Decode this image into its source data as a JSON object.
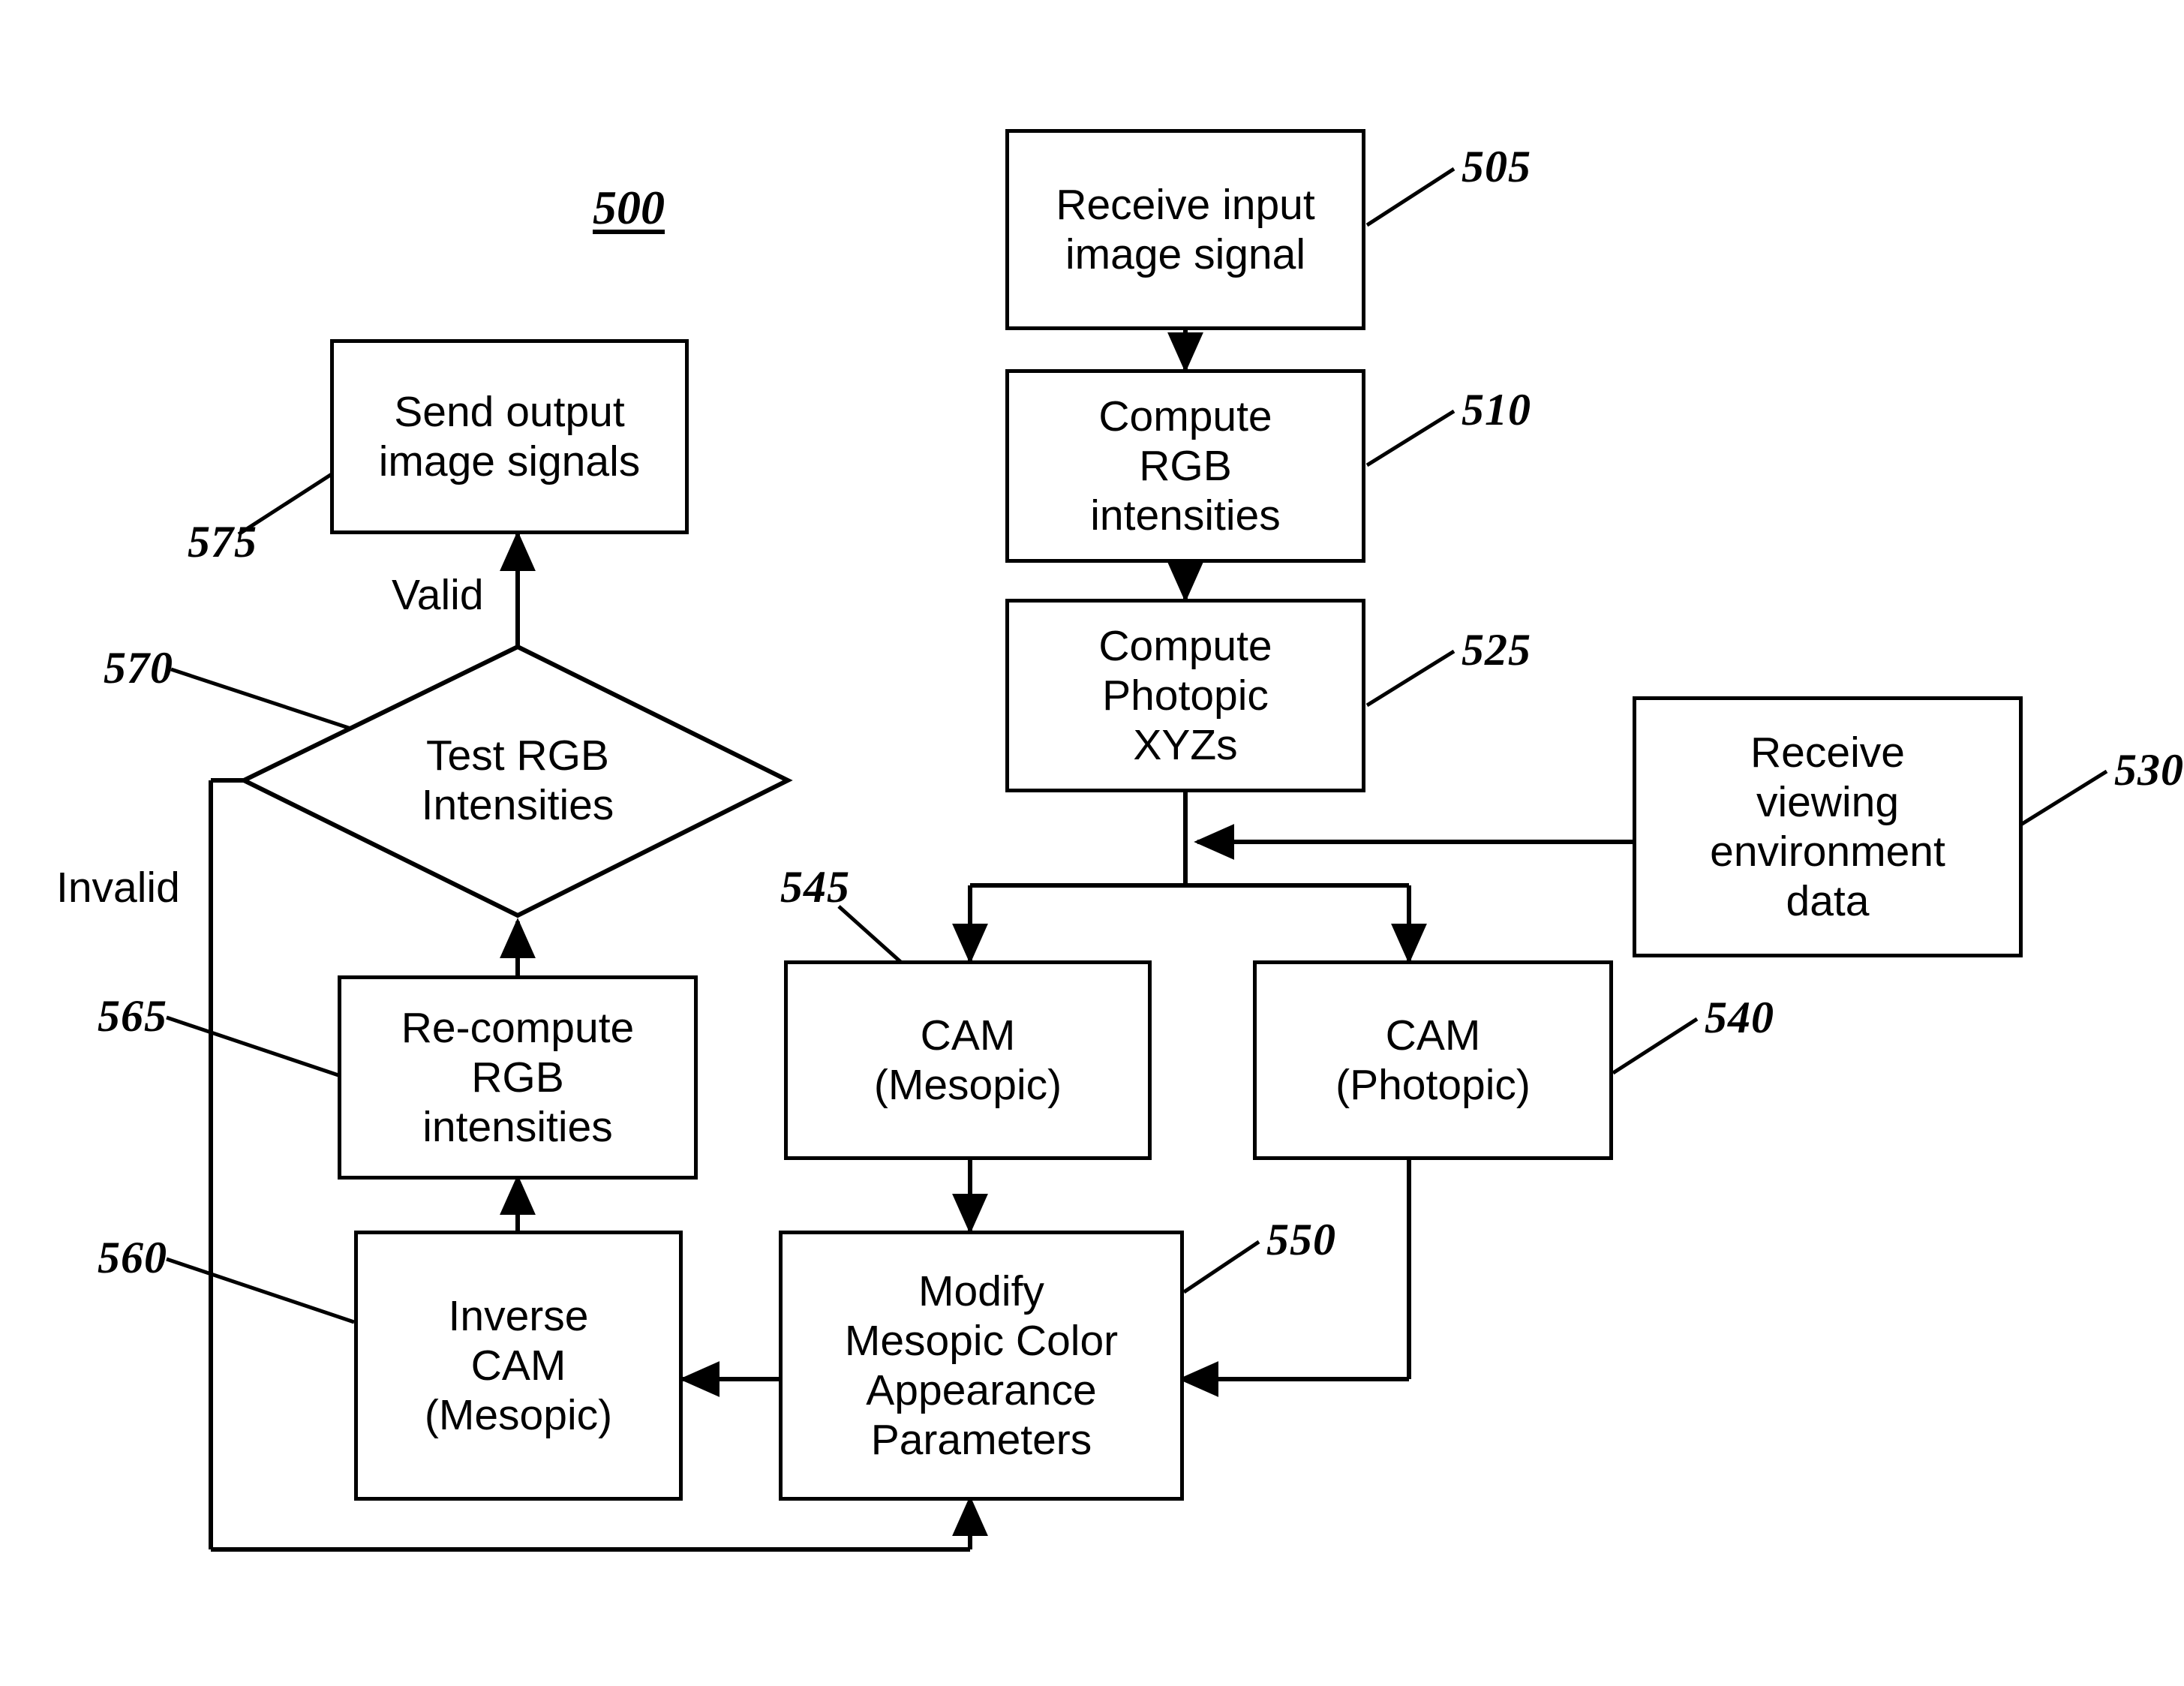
{
  "figure": {
    "title": "500"
  },
  "nodes": [
    {
      "id": "505",
      "label": "Receive input\nimage signal",
      "ref": "505"
    },
    {
      "id": "510",
      "label": "Compute\nRGB\nintensities",
      "ref": "510"
    },
    {
      "id": "525",
      "label": "Compute\nPhotopic\nXYZs",
      "ref": "525"
    },
    {
      "id": "530",
      "label": "Receive\nviewing\nenvironment\ndata",
      "ref": "530"
    },
    {
      "id": "545",
      "label": "CAM\n(Mesopic)",
      "ref": "545"
    },
    {
      "id": "540",
      "label": "CAM\n(Photopic)",
      "ref": "540"
    },
    {
      "id": "550",
      "label": "Modify\nMesopic Color\nAppearance\nParameters",
      "ref": "550"
    },
    {
      "id": "560",
      "label": "Inverse\nCAM\n(Mesopic)",
      "ref": "560"
    },
    {
      "id": "565",
      "label": "Re-compute\nRGB\nintensities",
      "ref": "565"
    },
    {
      "id": "570",
      "label": "Test RGB\nIntensities",
      "ref": "570"
    },
    {
      "id": "575",
      "label": "Send output\nimage signals",
      "ref": "575"
    }
  ],
  "edge_labels": {
    "valid": "Valid",
    "invalid": "Invalid"
  },
  "ref_labels": {
    "n505": "505",
    "n510": "510",
    "n525": "525",
    "n530": "530",
    "n540": "540",
    "n545": "545",
    "n550": "550",
    "n560": "560",
    "n565": "565",
    "n570": "570",
    "n575": "575"
  },
  "node_labels": {
    "receive_input": "Receive input\nimage signal",
    "compute_rgb": "Compute\nRGB\nintensities",
    "compute_photopic": "Compute\nPhotopic\nXYZs",
    "receive_viewing": "Receive\nviewing\nenvironment\ndata",
    "cam_mesopic": "CAM\n(Mesopic)",
    "cam_photopic": "CAM\n(Photopic)",
    "modify_params": "Modify\nMesopic Color\nAppearance\nParameters",
    "inverse_cam": "Inverse\nCAM\n(Mesopic)",
    "recompute_rgb": "Re-compute\nRGB\nintensities",
    "test_rgb": "Test RGB\nIntensities",
    "send_output": "Send output\nimage signals"
  },
  "colors": {
    "stroke": "#000000",
    "background": "#ffffff",
    "text": "#000000"
  }
}
